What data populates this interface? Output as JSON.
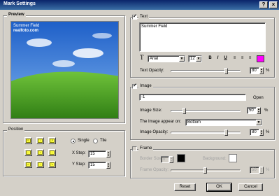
{
  "window": {
    "title": "Mark Settings",
    "buttons": {
      "help": "?",
      "close": "×"
    }
  },
  "preview": {
    "label": "Preview",
    "watermark_line1": "Summer Field",
    "watermark_line2": "realfoto.com"
  },
  "position": {
    "label": "Position",
    "arrows": [
      "↖",
      "↑",
      "↗",
      "←",
      "•",
      "→",
      "↙",
      "↓",
      "↘"
    ],
    "single_label": "Single",
    "tile_label": "Tile",
    "xstep_label": "X Step:",
    "xstep_value": "15",
    "ystep_label": "Y Step:",
    "ystep_value": "15"
  },
  "text_section": {
    "label": "Text",
    "text_value": "Summer Field",
    "font_icon": "T",
    "font_name": "Arial",
    "font_size": "12",
    "bold": "B",
    "italic": "I",
    "underline": "U",
    "opacity_label": "Text Opacity:",
    "opacity_value": "80",
    "opacity_level": 0.8,
    "percent": "%",
    "color": "#ff00ff"
  },
  "image_section": {
    "label": "Image",
    "path_value": "-1",
    "open_label": "Open",
    "size_label": "Image Size:",
    "size_value": "50",
    "size_level": 0.2,
    "appear_label": "The Image appear on:",
    "appear_value": "Bottom",
    "opacity_label": "Image Opacity:",
    "opacity_value": "80",
    "opacity_level": 0.8,
    "percent": "%"
  },
  "frame_section": {
    "label": "Frame",
    "border_size_label": "Border Size:",
    "border_size_value": "0",
    "background_label": "Background:",
    "opacity_label": "Frame Opacity:",
    "opacity_value": "50",
    "opacity_level": 0.5,
    "percent": "%"
  },
  "footer": {
    "reset": "Reset",
    "ok": "OK",
    "cancel": "Cancel"
  }
}
